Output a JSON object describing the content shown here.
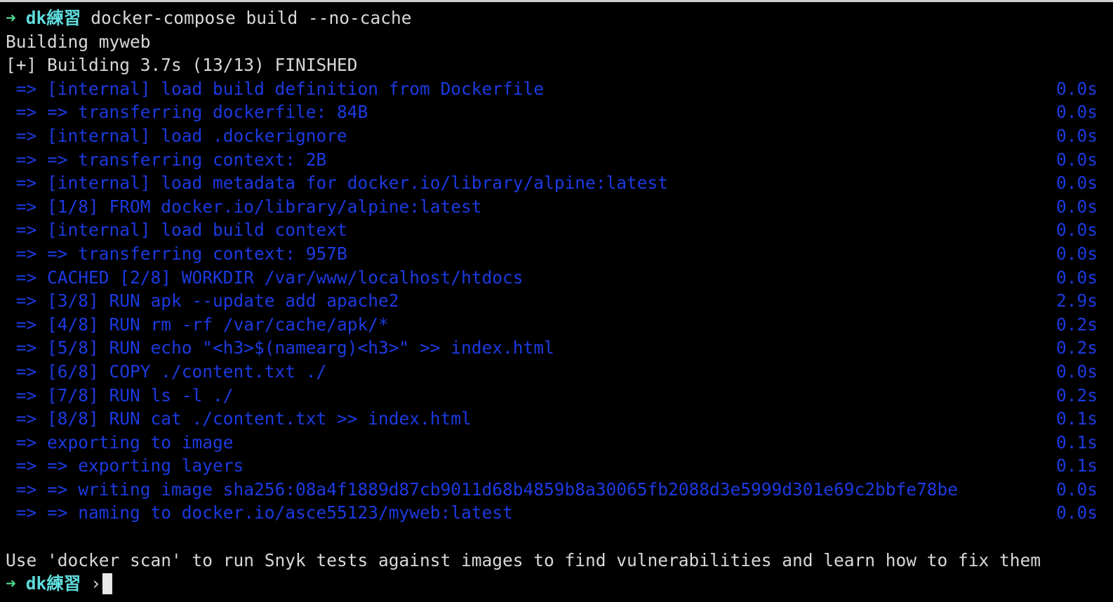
{
  "colors": {
    "background": "#000000",
    "text": "#d8d8d8",
    "buildkit_step": "#1c3ae0",
    "prompt_arrow": "#4fd68a",
    "prompt_dir": "#5fdcdc"
  },
  "prompt": {
    "arrow": "➜",
    "dir": "dk練習",
    "command": "docker-compose build --no-cache",
    "chevron": "›"
  },
  "output": {
    "building": "Building myweb",
    "summary": "[+] Building 3.7s (13/13) FINISHED",
    "steps": [
      {
        "text": " => [internal] load build definition from Dockerfile",
        "time": "0.0s"
      },
      {
        "text": " => => transferring dockerfile: 84B",
        "time": "0.0s"
      },
      {
        "text": " => [internal] load .dockerignore",
        "time": "0.0s"
      },
      {
        "text": " => => transferring context: 2B",
        "time": "0.0s"
      },
      {
        "text": " => [internal] load metadata for docker.io/library/alpine:latest",
        "time": "0.0s"
      },
      {
        "text": " => [1/8] FROM docker.io/library/alpine:latest",
        "time": "0.0s"
      },
      {
        "text": " => [internal] load build context",
        "time": "0.0s"
      },
      {
        "text": " => => transferring context: 957B",
        "time": "0.0s"
      },
      {
        "text": " => CACHED [2/8] WORKDIR /var/www/localhost/htdocs",
        "time": "0.0s"
      },
      {
        "text": " => [3/8] RUN apk --update add apache2",
        "time": "2.9s"
      },
      {
        "text": " => [4/8] RUN rm -rf /var/cache/apk/*",
        "time": "0.2s"
      },
      {
        "text": " => [5/8] RUN echo \"<h3>$(namearg)<h3>\" >> index.html",
        "time": "0.2s"
      },
      {
        "text": " => [6/8] COPY ./content.txt ./",
        "time": "0.0s"
      },
      {
        "text": " => [7/8] RUN ls -l ./",
        "time": "0.2s"
      },
      {
        "text": " => [8/8] RUN cat ./content.txt >> index.html",
        "time": "0.1s"
      },
      {
        "text": " => exporting to image",
        "time": "0.1s"
      },
      {
        "text": " => => exporting layers",
        "time": "0.1s"
      },
      {
        "text": " => => writing image sha256:08a4f1889d87cb9011d68b4859b8a30065fb2088d3e5999d301e69c2bbfe78be",
        "time": "0.0s"
      },
      {
        "text": " => => naming to docker.io/asce55123/myweb:latest",
        "time": "0.0s"
      }
    ],
    "hint": "Use 'docker scan' to run Snyk tests against images to find vulnerabilities and learn how to fix them"
  }
}
